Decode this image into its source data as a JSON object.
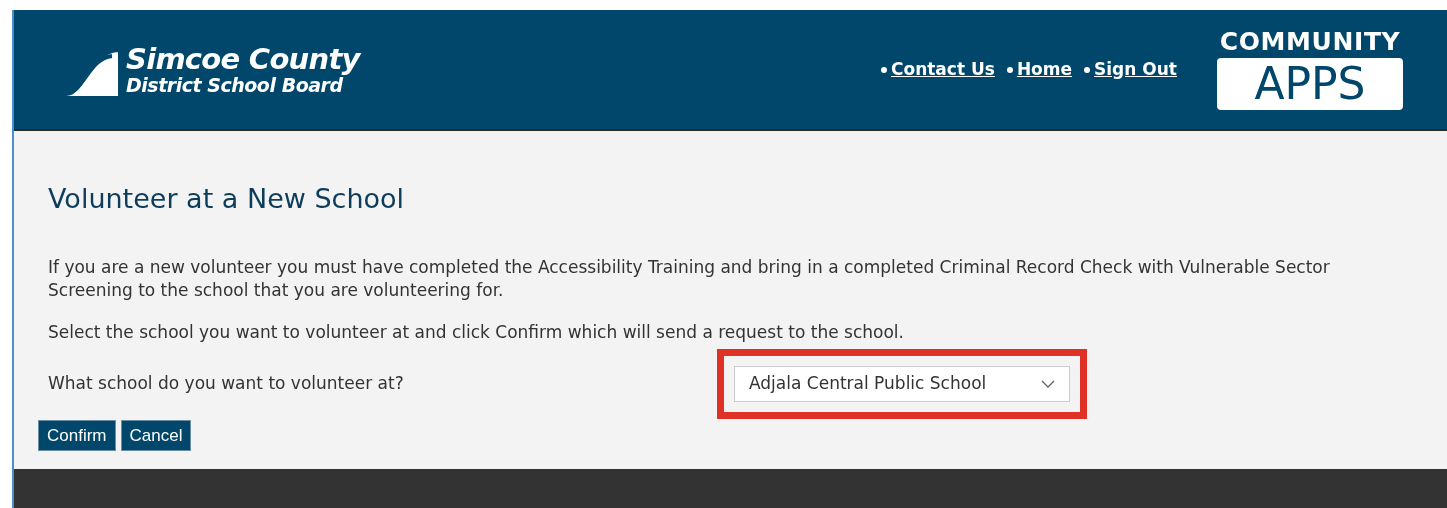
{
  "header": {
    "logo": {
      "line_1": "Simcoe County",
      "line_2": "District School Board"
    },
    "nav_links": [
      {
        "label": "Contact Us"
      },
      {
        "label": "Home"
      },
      {
        "label": "Sign Out"
      }
    ],
    "apps_logo": {
      "top": "COMMUNITY",
      "ticket": "APPS"
    }
  },
  "content": {
    "title": "Volunteer at a New School",
    "paragraphs": [
      "If you are a new volunteer you must have completed the Accessibility Training and bring in a completed Criminal Record Check with Vulnerable Sector Screening to the school that you are volunteering for.",
      "Select the school you want to volunteer at and click Confirm which will send a request to the school."
    ],
    "question": "What school do you want to volunteer at?",
    "school_select": {
      "value": "Adjala Central Public School",
      "highlighted": true
    },
    "buttons": [
      "Confirm",
      "Cancel"
    ]
  }
}
